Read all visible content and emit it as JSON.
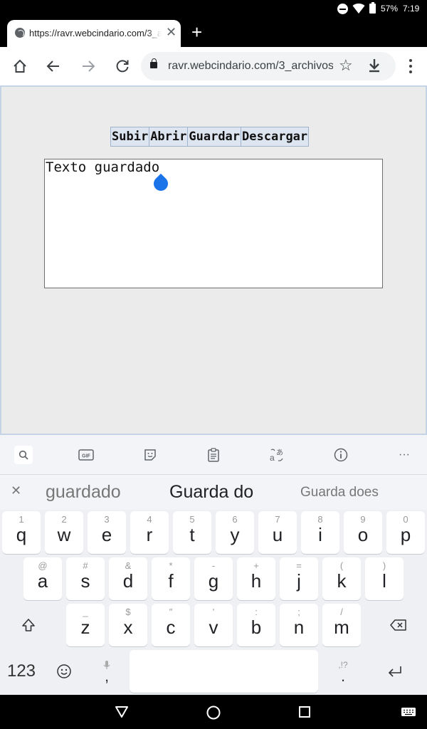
{
  "status_bar": {
    "battery": "57%",
    "time": "7:19"
  },
  "tab": {
    "title": "https://ravr.webcindario.com/3_archivos",
    "close": "✕",
    "new_tab": "+"
  },
  "toolbar": {
    "url": "ravr.webcindario.com/3_archivos"
  },
  "page": {
    "buttons": [
      "Subir",
      "Abrir",
      "Guardar",
      "Descargar"
    ],
    "textarea_value": "Texto guardado"
  },
  "keyboard": {
    "tools_more": "···",
    "suggestions": [
      "guardado",
      "Guarda do",
      "Guarda does"
    ],
    "row1": [
      {
        "k": "q",
        "s": "1"
      },
      {
        "k": "w",
        "s": "2"
      },
      {
        "k": "e",
        "s": "3"
      },
      {
        "k": "r",
        "s": "4"
      },
      {
        "k": "t",
        "s": "5"
      },
      {
        "k": "y",
        "s": "6"
      },
      {
        "k": "u",
        "s": "7"
      },
      {
        "k": "i",
        "s": "8"
      },
      {
        "k": "o",
        "s": "9"
      },
      {
        "k": "p",
        "s": "0"
      }
    ],
    "row2": [
      {
        "k": "a",
        "s": "@"
      },
      {
        "k": "s",
        "s": "#"
      },
      {
        "k": "d",
        "s": "&"
      },
      {
        "k": "f",
        "s": "*"
      },
      {
        "k": "g",
        "s": "-"
      },
      {
        "k": "h",
        "s": "+"
      },
      {
        "k": "j",
        "s": "="
      },
      {
        "k": "k",
        "s": "("
      },
      {
        "k": "l",
        "s": ")"
      }
    ],
    "row3": [
      {
        "k": "z",
        "s": "_"
      },
      {
        "k": "x",
        "s": "$"
      },
      {
        "k": "c",
        "s": "\""
      },
      {
        "k": "v",
        "s": "'"
      },
      {
        "k": "b",
        "s": ":"
      },
      {
        "k": "n",
        "s": ";"
      },
      {
        "k": "m",
        "s": "/"
      }
    ],
    "symbols_key": "123",
    "comma_key": ",",
    "period_key": ".",
    "period_sub": ",!?"
  }
}
